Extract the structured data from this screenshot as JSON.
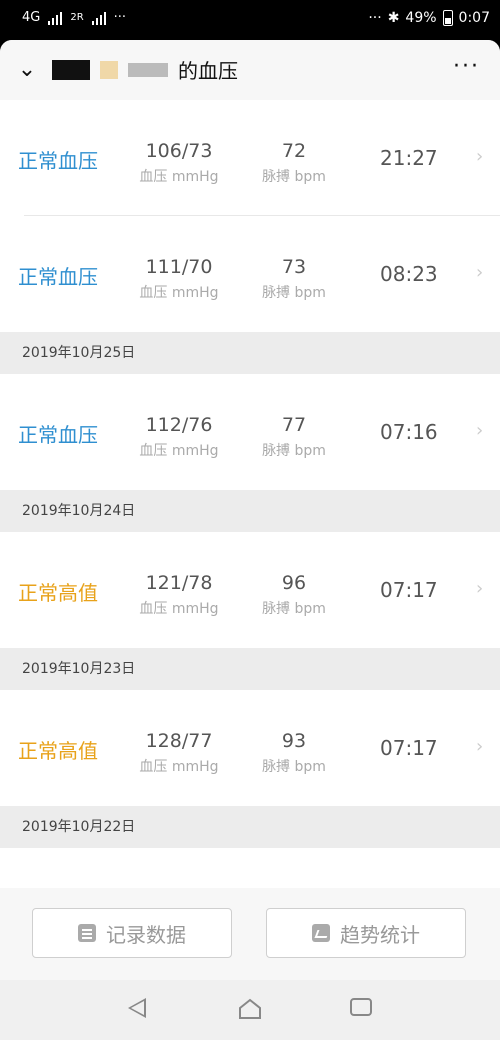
{
  "status_bar": {
    "network": "4G",
    "sim2": "2R",
    "dots_left": "···",
    "dots_right": "···",
    "battery_pct": "49%",
    "time": "0:07"
  },
  "header": {
    "title_suffix": "的血压",
    "more": "···"
  },
  "rows": [
    {
      "status": "正常血压",
      "status_color": "#2f8fd0",
      "bp": "106/73",
      "bp_unit": "血压 mmHg",
      "pulse": "72",
      "pulse_unit": "脉搏 bpm",
      "time": "21:27"
    },
    {
      "status": "正常血压",
      "status_color": "#2f8fd0",
      "bp": "111/70",
      "bp_unit": "血压 mmHg",
      "pulse": "73",
      "pulse_unit": "脉搏 bpm",
      "time": "08:23"
    },
    {
      "status": "正常血压",
      "status_color": "#2f8fd0",
      "bp": "112/76",
      "bp_unit": "血压 mmHg",
      "pulse": "77",
      "pulse_unit": "脉搏 bpm",
      "time": "07:16"
    },
    {
      "status": "正常高值",
      "status_color": "#e8a21a",
      "bp": "121/78",
      "bp_unit": "血压 mmHg",
      "pulse": "96",
      "pulse_unit": "脉搏 bpm",
      "time": "07:17"
    },
    {
      "status": "正常高值",
      "status_color": "#e8a21a",
      "bp": "128/77",
      "bp_unit": "血压 mmHg",
      "pulse": "93",
      "pulse_unit": "脉搏 bpm",
      "time": "07:17"
    }
  ],
  "dates": [
    "2019年10月25日",
    "2019年10月24日",
    "2019年10月23日",
    "2019年10月22日"
  ],
  "footer": {
    "record_label": "记录数据",
    "trend_label": "趋势统计"
  },
  "chevron": "›"
}
